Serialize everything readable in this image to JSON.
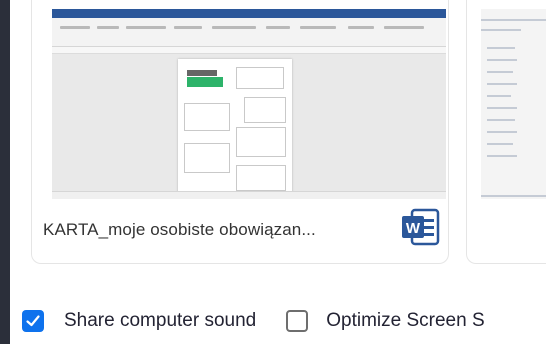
{
  "share_window": {
    "file_name": "KARTA_moje osobiste obowiązan...",
    "app_icon": "word-icon",
    "app_icon_letter": "W"
  },
  "options": {
    "share_sound_label": "Share computer sound",
    "share_sound_checked": true,
    "optimize_label": "Optimize Screen S",
    "optimize_checked": false
  },
  "colors": {
    "accent": "#0e72ed",
    "word_blue": "#2b579a"
  }
}
